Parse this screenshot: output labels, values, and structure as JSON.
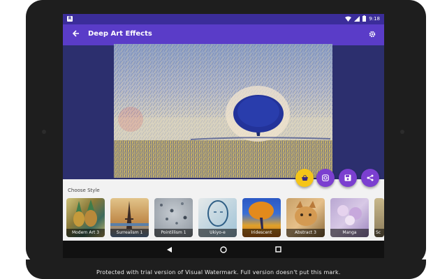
{
  "statusbar": {
    "notification_glyph": "R",
    "time": "9:18",
    "icons": [
      "wifi-icon",
      "signal-icon",
      "battery-icon"
    ]
  },
  "appbar": {
    "title": "Deep Art Effects",
    "back_icon": "arrow-left-icon",
    "settings_icon": "gear-icon"
  },
  "fabs": [
    {
      "name": "shop-fab",
      "icon": "basket-icon",
      "color": "#f5c518"
    },
    {
      "name": "instagram-fab",
      "icon": "instagram-icon",
      "color": "#7b3fd0"
    },
    {
      "name": "save-fab",
      "icon": "floppy-disk-icon",
      "color": "#7b3fd0"
    },
    {
      "name": "share-fab",
      "icon": "share-icon",
      "color": "#7b3fd0"
    }
  ],
  "panel": {
    "choose_label": "Choose Style",
    "styles": [
      {
        "label": "Modern Art 3"
      },
      {
        "label": "Surrealism 1"
      },
      {
        "label": "Pointillism 1"
      },
      {
        "label": "Ukiyo-e"
      },
      {
        "label": "Iridescent"
      },
      {
        "label": "Abstract 3"
      },
      {
        "label": "Manga"
      },
      {
        "label": "Sc"
      }
    ]
  },
  "navbar": {
    "icons": [
      "back-triangle-icon",
      "home-circle-icon",
      "recents-square-icon"
    ]
  },
  "watermark": "Protected with trial version of Visual Watermark. Full version doesn't put this mark.",
  "colors": {
    "appbar": "#5a3cc8",
    "statusbar": "#3b2d9a",
    "accent_fab": "#7b3fd0",
    "shop_fab": "#f5c518"
  }
}
